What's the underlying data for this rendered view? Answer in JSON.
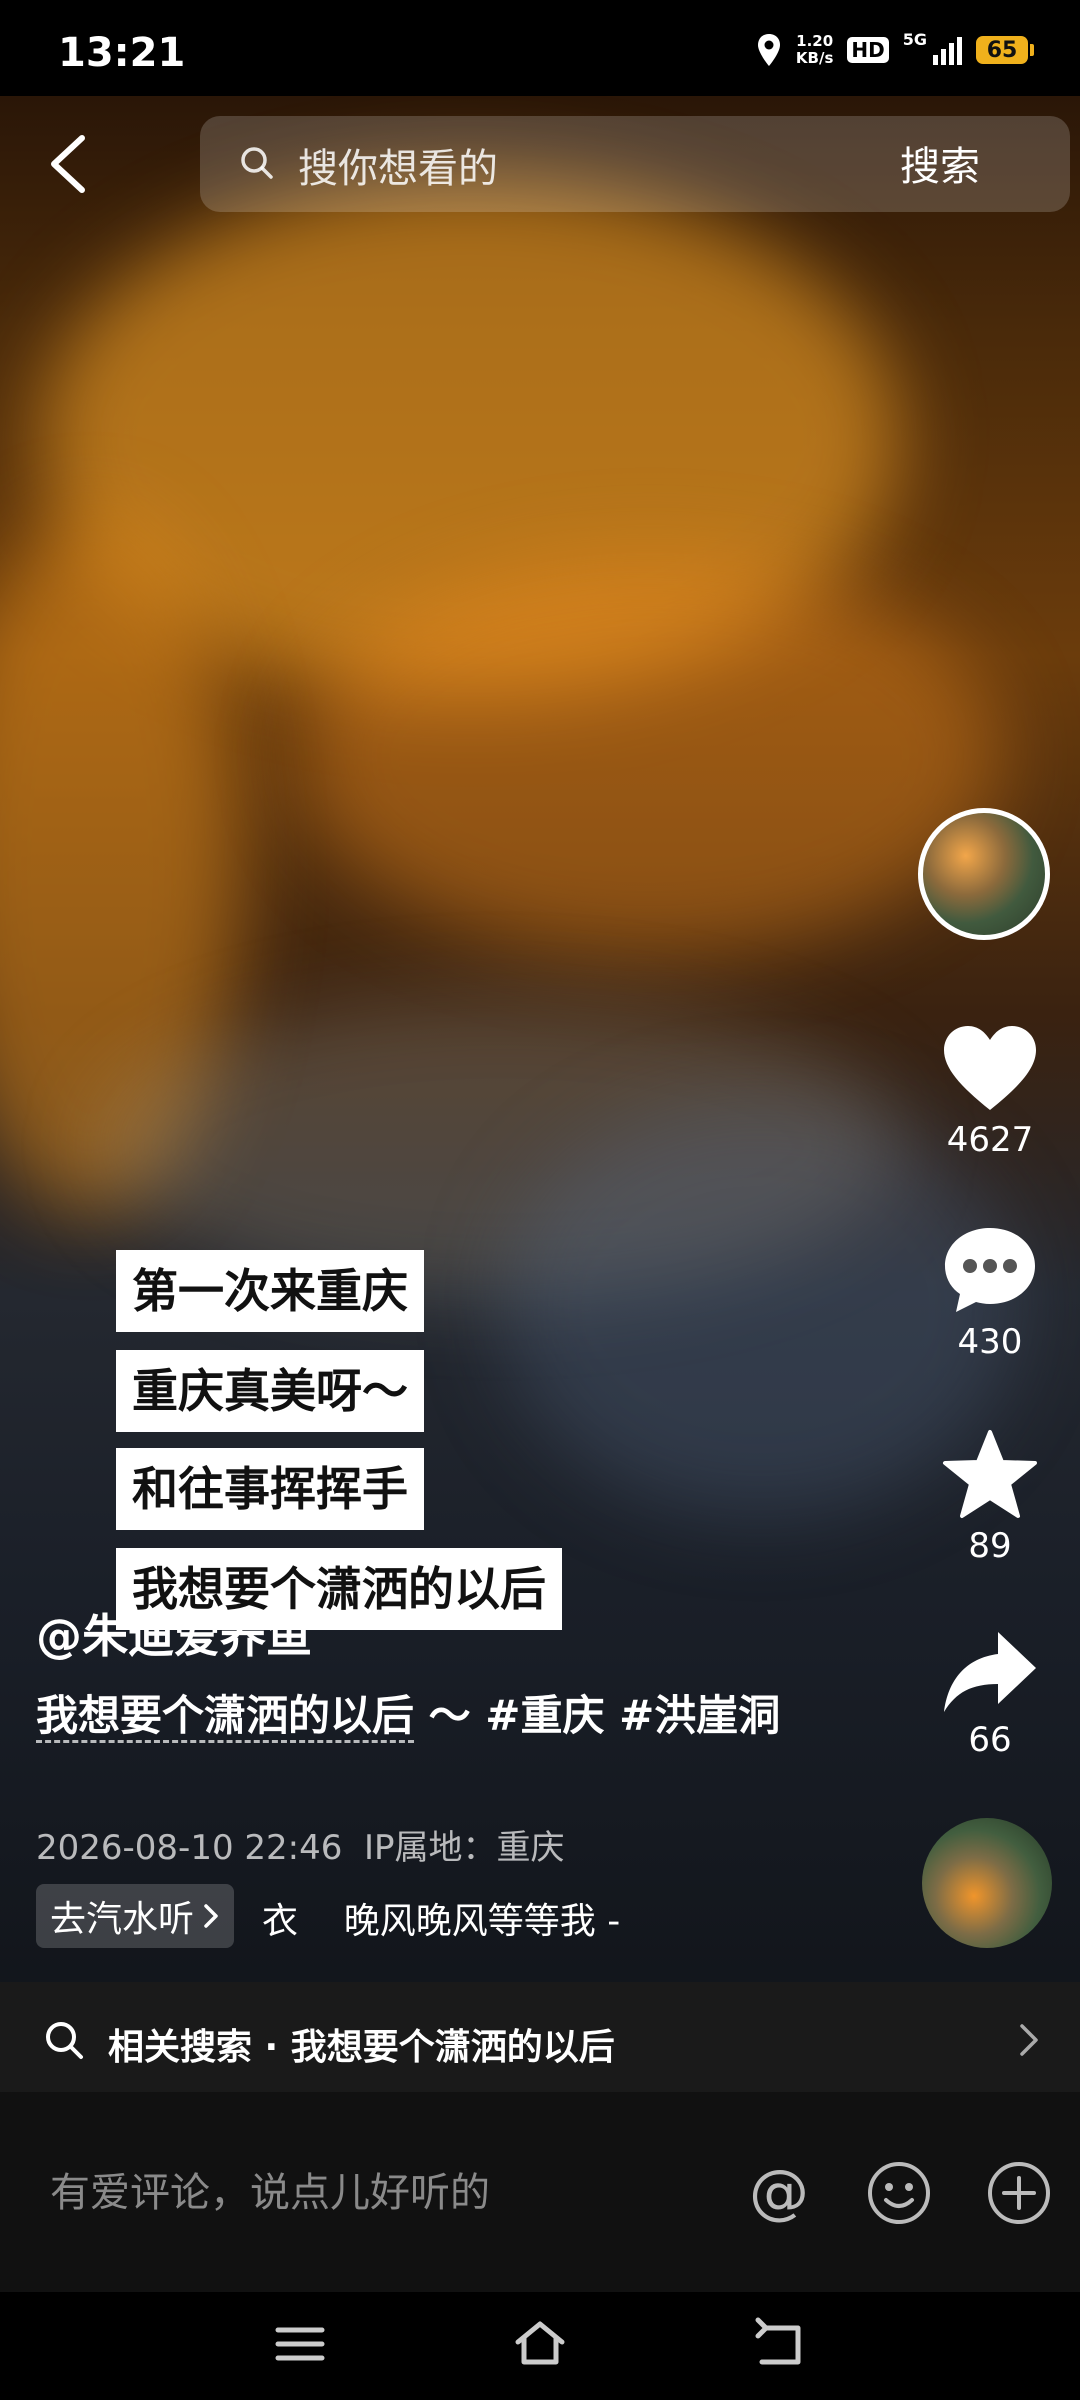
{
  "status": {
    "time": "13:21",
    "net_speed_value": "1.20",
    "net_speed_unit": "KB/s",
    "hd": "HD",
    "network": "5G",
    "battery": "65"
  },
  "search": {
    "placeholder": "搜你想看的",
    "button": "搜索"
  },
  "captions": [
    "第一次来重庆",
    "重庆真美呀～",
    "和往事挥挥手",
    "我想要个潇洒的以后"
  ],
  "actions": {
    "likes": "4627",
    "comments": "430",
    "favorites": "89",
    "shares": "66"
  },
  "post": {
    "author": "@朱迪爱养鱼",
    "title": "我想要个潇洒的以后",
    "desc_rest": " ～ #重庆 #洪崖洞",
    "datetime": "2026-08-10 22:46",
    "ip_location": "IP属地：重庆",
    "music_chip": "去汽水听",
    "music_scroll": "衣    晚风晚风等等我 -"
  },
  "related": {
    "text": "相关搜索 · 我想要个潇洒的以后"
  },
  "comment": {
    "placeholder": "有爱评论，说点儿好听的"
  },
  "icons": {
    "back": "back-arrow-icon",
    "search": "search-icon",
    "like": "heart-icon",
    "comment": "comment-bubble-icon",
    "favorite": "star-icon",
    "share": "share-arrow-icon",
    "mention": "at-icon",
    "emoji": "emoji-icon",
    "add": "plus-circle-icon",
    "nav_menu": "menu-icon",
    "nav_home": "home-icon",
    "nav_back": "back-icon"
  },
  "colors": {
    "battery": "#f0b11c",
    "background": "#000000"
  }
}
